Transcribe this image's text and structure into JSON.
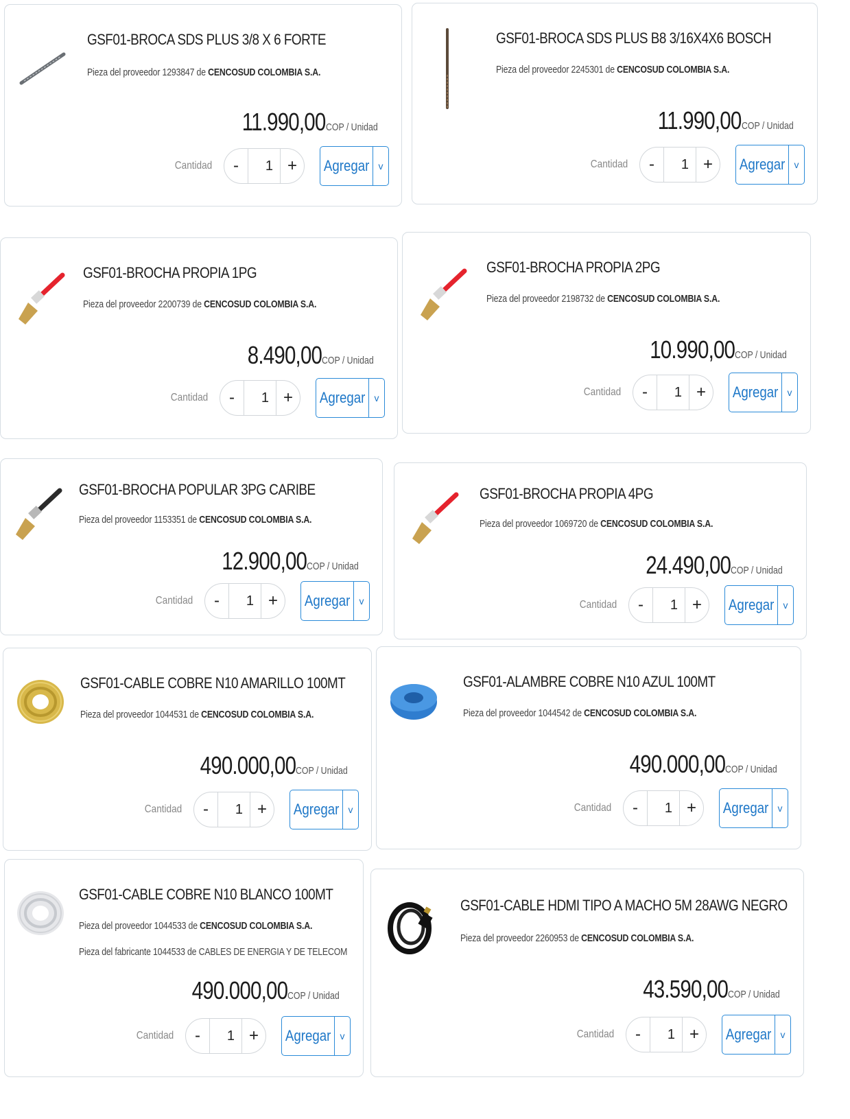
{
  "labels": {
    "qty": "Cantidad",
    "add": "Agregar",
    "unit": "COP / Unidad",
    "supplier_prefix": "Pieza del proveedor",
    "maker_prefix": "Pieza del fabricante",
    "of": "de",
    "minus": "-",
    "plus": "+",
    "caret": "v"
  },
  "products": [
    {
      "title": "GSF01-BROCA SDS PLUS 3/8 X 6 FORTE",
      "supplier_code": "1293847",
      "supplier": "CENCOSUD COLOMBIA S.A.",
      "price": "11.990,00",
      "qty": "1",
      "thumb": "drill-bit-icon"
    },
    {
      "title": "GSF01-BROCA SDS PLUS B8 3/16X4X6 BOSCH",
      "supplier_code": "2245301",
      "supplier": "CENCOSUD COLOMBIA S.A.",
      "price": "11.990,00",
      "qty": "1",
      "thumb": "drill-bit-icon"
    },
    {
      "title": "GSF01-BROCHA PROPIA 1PG",
      "supplier_code": "2200739",
      "supplier": "CENCOSUD COLOMBIA S.A.",
      "price": "8.490,00",
      "qty": "1",
      "thumb": "brush-icon"
    },
    {
      "title": "GSF01-BROCHA PROPIA 2PG",
      "supplier_code": "2198732",
      "supplier": "CENCOSUD COLOMBIA S.A.",
      "price": "10.990,00",
      "qty": "1",
      "thumb": "brush-icon"
    },
    {
      "title": "GSF01-BROCHA POPULAR 3PG CARIBE",
      "supplier_code": "1153351",
      "supplier": "CENCOSUD COLOMBIA S.A.",
      "price": "12.900,00",
      "qty": "1",
      "thumb": "brush-icon"
    },
    {
      "title": "GSF01-BROCHA PROPIA 4PG",
      "supplier_code": "1069720",
      "supplier": "CENCOSUD COLOMBIA S.A.",
      "price": "24.490,00",
      "qty": "1",
      "thumb": "brush-icon"
    },
    {
      "title": "GSF01-CABLE COBRE N10 AMARILLO 100MT",
      "supplier_code": "1044531",
      "supplier": "CENCOSUD COLOMBIA S.A.",
      "price": "490.000,00",
      "qty": "1",
      "thumb": "cable-coil-icon"
    },
    {
      "title": "GSF01-ALAMBRE COBRE N10 AZUL 100MT",
      "supplier_code": "1044542",
      "supplier": "CENCOSUD COLOMBIA S.A.",
      "price": "490.000,00",
      "qty": "1",
      "thumb": "cable-coil-icon"
    },
    {
      "title": "GSF01-CABLE COBRE N10 BLANCO 100MT",
      "supplier_code": "1044533",
      "supplier": "CENCOSUD COLOMBIA S.A.",
      "maker_code": "1044533",
      "maker": "CABLES DE ENERGIA Y DE TELECOM",
      "price": "490.000,00",
      "qty": "1",
      "thumb": "cable-coil-icon"
    },
    {
      "title": "GSF01-CABLE HDMI TIPO A MACHO 5M 28AWG NEGRO",
      "supplier_code": "2260953",
      "supplier": "CENCOSUD COLOMBIA S.A.",
      "price": "43.590,00",
      "qty": "1",
      "thumb": "hdmi-cable-icon"
    }
  ],
  "colors": {
    "accent": "#1f78c8",
    "border": "#d6dde3"
  }
}
